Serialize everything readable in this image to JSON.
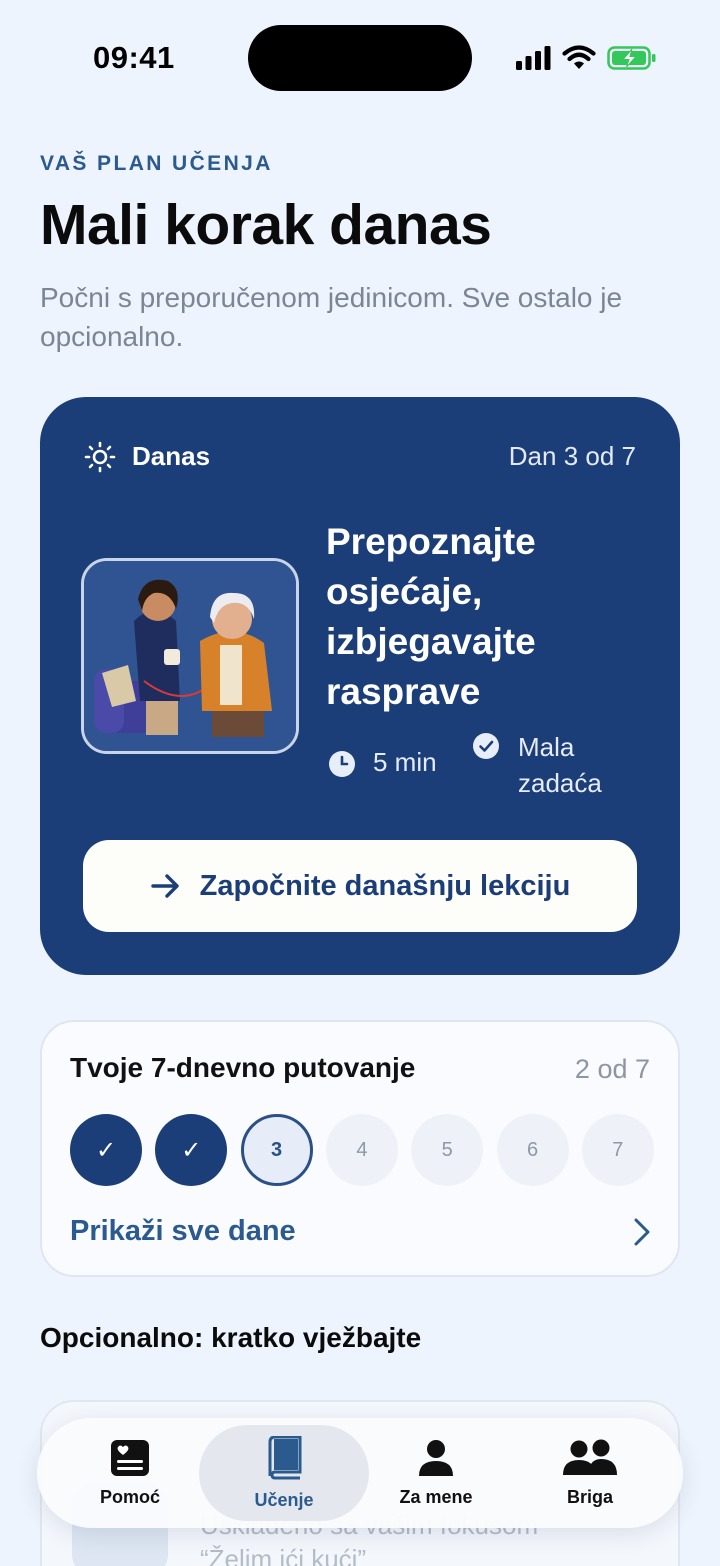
{
  "status": {
    "time": "09:41",
    "icons": [
      "signal-icon",
      "wifi-icon",
      "battery-charging-icon"
    ]
  },
  "header": {
    "kicker": "VAŠ PLAN UČENJA",
    "title": "Mali korak danas",
    "subtitle": "Počni s preporučenom jedinicom. Sve ostalo je opcionalno."
  },
  "today": {
    "label": "Danas",
    "day": "Dan 3 od 7",
    "lesson_title": "Prepoznajte osjećaje, izbjegavajte rasprave",
    "duration": "5 min",
    "task": "Mala zadaća",
    "button_label": "Započnite današnju lekciju"
  },
  "journey": {
    "title": "Tvoje 7-dnevno putovanje",
    "count": "2 od 7",
    "days": [
      {
        "label": "✓",
        "state": "done"
      },
      {
        "label": "✓",
        "state": "done"
      },
      {
        "label": "3",
        "state": "current"
      },
      {
        "label": "4",
        "state": "todo"
      },
      {
        "label": "5",
        "state": "todo"
      },
      {
        "label": "6",
        "state": "todo"
      },
      {
        "label": "7",
        "state": "todo"
      }
    ],
    "show_all": "Prikaži sve dane"
  },
  "optional": {
    "title": "Opcionalno: kratko vježbajte",
    "peek_line1": "Usklađeno sa vašim fokusom",
    "peek_line2": "“Želim ići kući”"
  },
  "tabs": [
    {
      "label": "Pomoć",
      "icon": "help-card-icon",
      "active": false
    },
    {
      "label": "Učenje",
      "icon": "book-icon",
      "active": true
    },
    {
      "label": "Za mene",
      "icon": "person-icon",
      "active": false
    },
    {
      "label": "Briga",
      "icon": "people-icon",
      "active": false
    }
  ],
  "colors": {
    "primary": "#1c3e78",
    "accent": "#2b5a8f",
    "background": "#eef4fd"
  }
}
